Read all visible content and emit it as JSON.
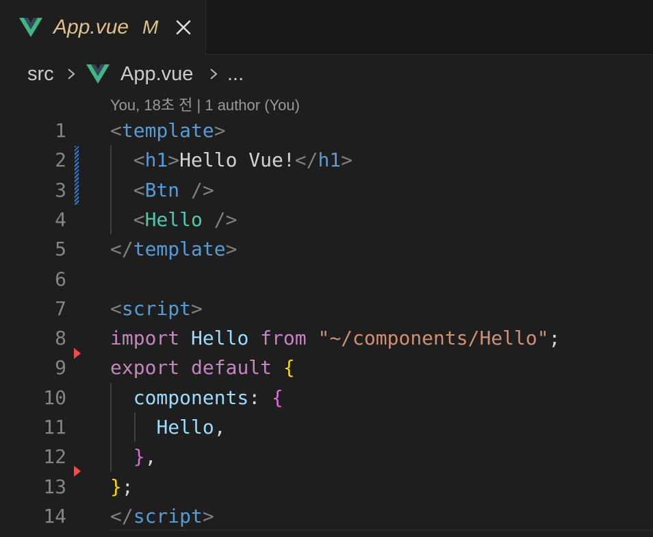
{
  "colors": {
    "vue_green": "#41b883",
    "vue_dark": "#35495e",
    "modified": "#e2c08d",
    "keyword": "#c586c0",
    "tag": "#569cd6",
    "component": "#4ec9b0",
    "string": "#ce9178",
    "identifier": "#9cdcfe"
  },
  "tab": {
    "icon": "vue-icon",
    "filename": "App.vue",
    "status": "M",
    "close_icon": "close-icon"
  },
  "breadcrumb": {
    "folder": "src",
    "separator_icon": "chevron-right-icon",
    "file_icon": "vue-icon",
    "file": "App.vue",
    "more": "..."
  },
  "blame": "You, 18초 전 | 1 author (You)",
  "lines": [
    {
      "n": "1",
      "tokens": [
        [
          "tk-punct",
          "<"
        ],
        [
          "tk-tag",
          "template"
        ],
        [
          "tk-punct",
          ">"
        ]
      ]
    },
    {
      "n": "2",
      "tokens": [
        [
          "tk-text",
          "  "
        ],
        [
          "tk-punct",
          "<"
        ],
        [
          "tk-tag",
          "h1"
        ],
        [
          "tk-punct",
          ">"
        ],
        [
          "tk-text",
          "Hello Vue!"
        ],
        [
          "tk-punct",
          "</"
        ],
        [
          "tk-tag",
          "h1"
        ],
        [
          "tk-punct",
          ">"
        ]
      ]
    },
    {
      "n": "3",
      "tokens": [
        [
          "tk-text",
          "  "
        ],
        [
          "tk-punct",
          "<"
        ],
        [
          "tk-tag",
          "Btn"
        ],
        [
          "tk-punct",
          " />"
        ]
      ]
    },
    {
      "n": "4",
      "tokens": [
        [
          "tk-text",
          "  "
        ],
        [
          "tk-punct",
          "<"
        ],
        [
          "tk-comp",
          "Hello"
        ],
        [
          "tk-punct",
          " />"
        ]
      ]
    },
    {
      "n": "5",
      "tokens": [
        [
          "tk-punct",
          "</"
        ],
        [
          "tk-tag",
          "template"
        ],
        [
          "tk-punct",
          ">"
        ]
      ]
    },
    {
      "n": "6",
      "tokens": []
    },
    {
      "n": "7",
      "tokens": [
        [
          "tk-punct",
          "<"
        ],
        [
          "tk-tag",
          "script"
        ],
        [
          "tk-punct",
          ">"
        ]
      ]
    },
    {
      "n": "8",
      "tokens": [
        [
          "tk-kw",
          "import"
        ],
        [
          "tk-text",
          " "
        ],
        [
          "tk-id",
          "Hello"
        ],
        [
          "tk-text",
          " "
        ],
        [
          "tk-kw",
          "from"
        ],
        [
          "tk-text",
          " "
        ],
        [
          "tk-str",
          "\"~/components/Hello\""
        ],
        [
          "tk-text",
          ";"
        ]
      ]
    },
    {
      "n": "9",
      "tokens": [
        [
          "tk-kw",
          "export"
        ],
        [
          "tk-text",
          " "
        ],
        [
          "tk-kw",
          "default"
        ],
        [
          "tk-text",
          " "
        ],
        [
          "tk-brace1",
          "{"
        ]
      ]
    },
    {
      "n": "10",
      "tokens": [
        [
          "tk-text",
          "  "
        ],
        [
          "tk-id",
          "components"
        ],
        [
          "tk-text",
          ": "
        ],
        [
          "tk-brace2",
          "{"
        ]
      ]
    },
    {
      "n": "11",
      "tokens": [
        [
          "tk-text",
          "    "
        ],
        [
          "tk-id",
          "Hello"
        ],
        [
          "tk-text",
          ","
        ]
      ]
    },
    {
      "n": "12",
      "tokens": [
        [
          "tk-text",
          "  "
        ],
        [
          "tk-brace2",
          "}"
        ],
        [
          "tk-text",
          ","
        ]
      ]
    },
    {
      "n": "13",
      "tokens": [
        [
          "tk-brace1",
          "}"
        ],
        [
          "tk-text",
          ";"
        ]
      ]
    },
    {
      "n": "14",
      "tokens": [
        [
          "tk-punct",
          "</"
        ],
        [
          "tk-tag",
          "script"
        ],
        [
          "tk-punct",
          ">"
        ]
      ]
    }
  ]
}
